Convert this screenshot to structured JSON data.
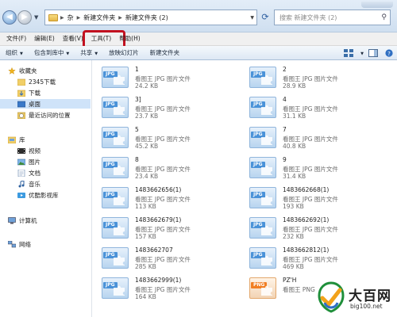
{
  "address_bar": {
    "breadcrumbs": [
      "杂",
      "新建文件夹",
      "新建文件夹 (2)"
    ],
    "search_placeholder": "搜索 新建文件夹 (2)"
  },
  "menu": {
    "file": "文件(F)",
    "edit": "编辑(E)",
    "view": "查看(V)",
    "tools": "工具(T)",
    "help": "帮助(H)"
  },
  "toolbar": {
    "organize": "组织",
    "include_library": "包含到库中",
    "share": "共享",
    "slideshow": "放映幻灯片",
    "new_folder": "新建文件夹"
  },
  "nav": {
    "favorites": "收藏夹",
    "downloads_2345": "2345下载",
    "downloads": "下载",
    "desktop": "桌面",
    "recent": "最近访问的位置",
    "libraries": "库",
    "videos": "视频",
    "pictures": "图片",
    "documents": "文档",
    "music": "音乐",
    "youku": "优酷影视库",
    "computer": "计算机",
    "network": "网络"
  },
  "files": [
    {
      "name": "1",
      "type": "看图王 JPG 图片文件",
      "size": "24.2 KB",
      "badge": "JPG"
    },
    {
      "name": "2",
      "type": "看图王 JPG 图片文件",
      "size": "28.9 KB",
      "badge": "JPG"
    },
    {
      "name": "3]",
      "type": "看图王 JPG 图片文件",
      "size": "23.7 KB",
      "badge": "JPG"
    },
    {
      "name": "4",
      "type": "看图王 JPG 图片文件",
      "size": "31.1 KB",
      "badge": "JPG"
    },
    {
      "name": "5",
      "type": "看图王 JPG 图片文件",
      "size": "45.2 KB",
      "badge": "JPG"
    },
    {
      "name": "7",
      "type": "看图王 JPG 图片文件",
      "size": "40.8 KB",
      "badge": "JPG"
    },
    {
      "name": "8",
      "type": "看图王 JPG 图片文件",
      "size": "23.4 KB",
      "badge": "JPG"
    },
    {
      "name": "9",
      "type": "看图王 JPG 图片文件",
      "size": "31.4 KB",
      "badge": "JPG"
    },
    {
      "name": "1483662656(1)",
      "type": "看图王 JPG 图片文件",
      "size": "113 KB",
      "badge": "JPG"
    },
    {
      "name": "1483662668(1)",
      "type": "看图王 JPG 图片文件",
      "size": "193 KB",
      "badge": "JPG"
    },
    {
      "name": "1483662679(1)",
      "type": "看图王 JPG 图片文件",
      "size": "157 KB",
      "badge": "JPG"
    },
    {
      "name": "1483662692(1)",
      "type": "看图王 JPG 图片文件",
      "size": "232 KB",
      "badge": "JPG"
    },
    {
      "name": "1483662707",
      "type": "看图王 JPG 图片文件",
      "size": "285 KB",
      "badge": "JPG"
    },
    {
      "name": "1483662812(1)",
      "type": "看图王 JPG 图片文件",
      "size": "469 KB",
      "badge": "JPG"
    },
    {
      "name": "1483662999(1)",
      "type": "看图王 JPG 图片文件",
      "size": "164 KB",
      "badge": "JPG"
    },
    {
      "name": "PZ'H",
      "type": "看图王 PNG",
      "size": "",
      "badge": "PNG"
    }
  ],
  "watermark": {
    "title": "大百网",
    "subtitle": "big100.net"
  }
}
